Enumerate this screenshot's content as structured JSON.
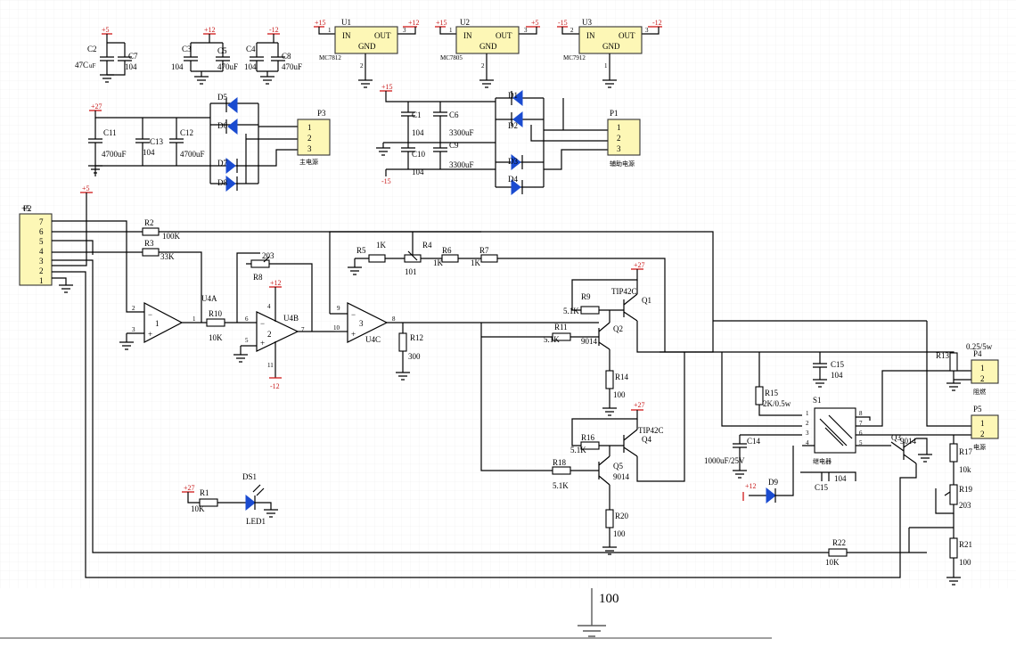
{
  "chips": [
    {
      "ref": "U1",
      "in_label": "IN",
      "out_label": "OUT",
      "gnd_label": "GND",
      "part": "MC7812",
      "vin": "+15",
      "vout": "+12",
      "pin_in": "1",
      "pin_out": "3",
      "pin_gnd": "2"
    },
    {
      "ref": "U2",
      "in_label": "IN",
      "out_label": "OUT",
      "gnd_label": "GND",
      "part": "MC7805",
      "vin": "+15",
      "vout": "+5",
      "pin_in": "1",
      "pin_out": "3",
      "pin_gnd": "2"
    },
    {
      "ref": "U3",
      "in_label": "IN",
      "out_label": "OUT",
      "gnd_label": "GND",
      "part": "MC7912",
      "vin": "-15",
      "vout": "-12",
      "pin_in": "2",
      "pin_out": "3",
      "pin_gnd": "1"
    }
  ],
  "rails": {
    "p5": "+5",
    "p12": "+12",
    "m12": "-12",
    "p15": "+15",
    "m15": "-15",
    "p27": "+27"
  },
  "caps": {
    "C2": "C2",
    "C2v": "47C",
    "C2u": "uF",
    "C7": "C7",
    "C7v": "104",
    "C3": "C3",
    "C3v": "104",
    "C5": "C5",
    "C5v": "470uF",
    "C4": "C4",
    "C4v": "104",
    "C8": "C8",
    "C8v": "470uF",
    "C11": "C11",
    "C11v": "4700uF",
    "C13": "C13",
    "C13v": "104",
    "C12": "C12",
    "C12v": "4700uF",
    "C1": "C1",
    "C1v": "104",
    "C6": "C6",
    "C6v": "3300uF",
    "C10": "C10",
    "C10v": "104",
    "C9": "C9",
    "C9v": "3300uF",
    "C15": "C15",
    "C15v": "104",
    "C14": "C14",
    "C14v": "1000uF/25V",
    "C15b": "C15",
    "C15bv": "104"
  },
  "diodes": {
    "D1": "D1",
    "D2": "D2",
    "D3": "D3",
    "D4": "D4",
    "D5": "D5",
    "D6": "D6",
    "D7": "D7",
    "D8": "D8",
    "D9": "D9"
  },
  "connectors": {
    "P1": {
      "ref": "P1",
      "pins": [
        "1",
        "2",
        "3"
      ],
      "caption": "辅助电源"
    },
    "P3": {
      "ref": "P3",
      "pins": [
        "1",
        "2",
        "3"
      ],
      "caption": "主电源"
    },
    "P2": {
      "ref": "P2",
      "pins": [
        "7",
        "6",
        "5",
        "4",
        "3",
        "2",
        "1"
      ]
    },
    "P4": {
      "ref": "P4",
      "pins": [
        "1",
        "2"
      ],
      "caption": "阻燃"
    },
    "P5": {
      "ref": "P5",
      "pins": [
        "1",
        "2"
      ],
      "caption": "电源"
    }
  },
  "resistors": {
    "R2": "R2",
    "R2v": "100K",
    "R3": "R3",
    "R3v": "33K",
    "R10": "R10",
    "R10v": "10K",
    "R8": "R8",
    "R8v": "203",
    "R5": "R5",
    "R5v": "1K",
    "R4": "R4",
    "R4v": "101",
    "R6": "R6",
    "R6v": "1K",
    "R7": "R7",
    "R7v": "1K",
    "R12": "R12",
    "R12v": "300",
    "R9": "R9",
    "R9v": "5.1K",
    "R11": "R11",
    "R11v": "5.1K",
    "R14": "R14",
    "R14v": "100",
    "R16": "R16",
    "R16v": "5.1K",
    "R18": "R18",
    "R18v": "5.1K",
    "R20": "R20",
    "R20v": "100",
    "R15": "R15",
    "R15v": "2K/0.5w",
    "R13": "R13",
    "R13v": "0.25/5w",
    "R17": "R17",
    "R17v": "10k",
    "R19": "R19",
    "R19v": "203",
    "R21": "R21",
    "R21v": "100",
    "R22": "R22",
    "R22v": "10K",
    "R1": "R1",
    "R1v": "10K"
  },
  "transistors": {
    "Q1": "Q1",
    "Q1v": "TIP42C",
    "Q2": "Q2",
    "Q2v": "9014",
    "Q4": "Q4",
    "Q4v": "TIP42C",
    "Q5": "Q5",
    "Q5v": "9014",
    "Q3": "Q3",
    "Q3v": "9014"
  },
  "opamps": {
    "U4A": "U4A",
    "U4B": "U4B",
    "U4C": "U4C",
    "a_p1": "1",
    "a_p2": "2",
    "a_p3": "3",
    "b_p5": "5",
    "b_p6": "6",
    "b_p7": "7",
    "b_p4": "4",
    "b_p11": "11",
    "c_p8": "8",
    "c_p9": "9",
    "c_p10": "10",
    "num1": "1",
    "num2": "2",
    "num3": "3"
  },
  "relay": {
    "ref": "S1",
    "caption": "继电器",
    "pins": [
      "1",
      "2",
      "3",
      "4",
      "8",
      "7",
      "6",
      "5"
    ]
  },
  "led": {
    "ref": "DS1",
    "label": "LED1"
  },
  "bottom": {
    "label": "100"
  }
}
